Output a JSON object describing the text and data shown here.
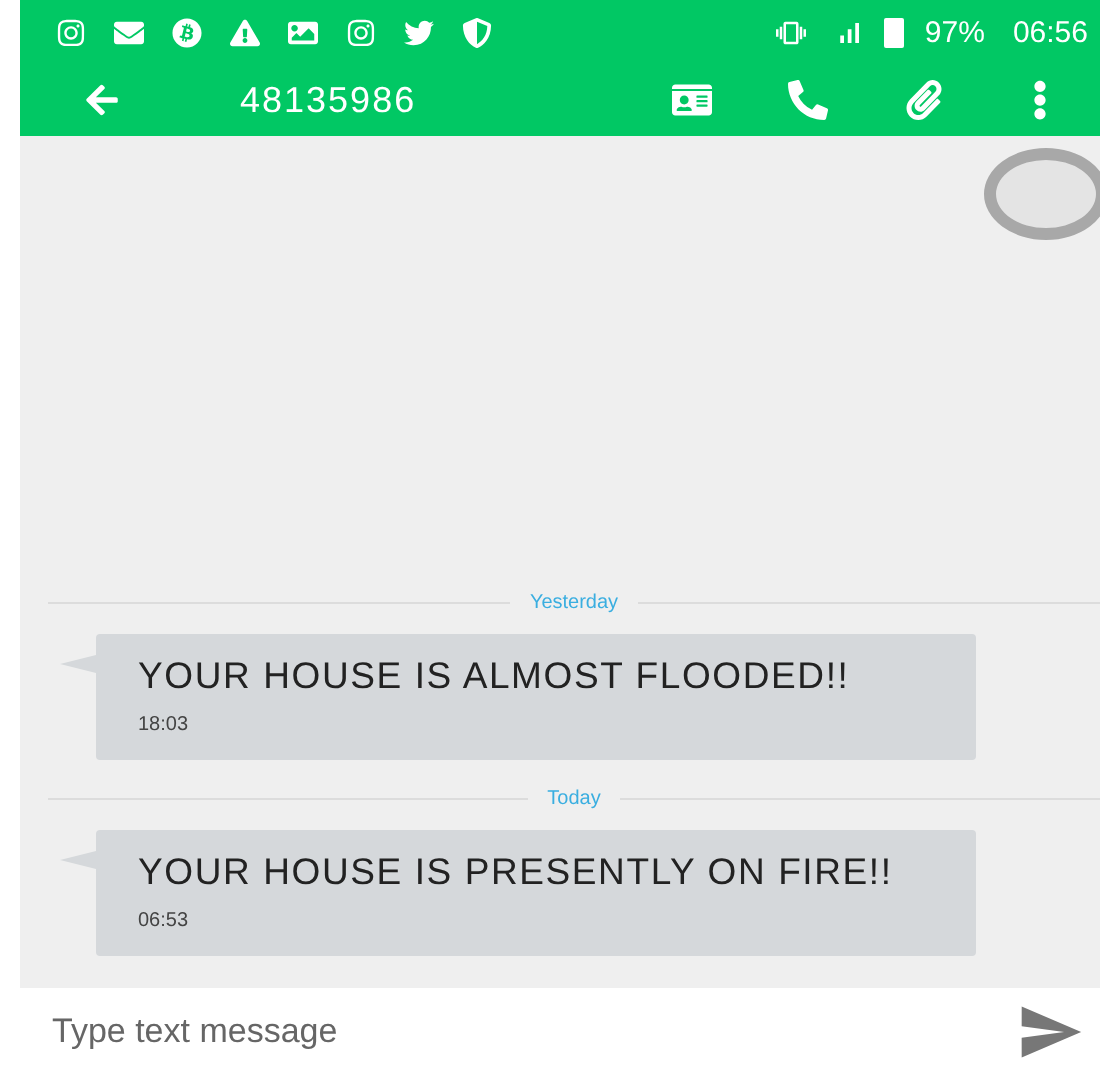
{
  "status_bar": {
    "battery": "97%",
    "time": "06:56"
  },
  "toolbar": {
    "contact": "48135986"
  },
  "conversation": [
    {
      "kind": "divider",
      "label": "Yesterday"
    },
    {
      "kind": "message",
      "text": "YOUR HOUSE IS ALMOST FLOODED!!",
      "time": "18:03"
    },
    {
      "kind": "divider",
      "label": "Today"
    },
    {
      "kind": "message",
      "text": "YOUR HOUSE IS PRESENTLY ON FIRE!!",
      "time": "06:53"
    }
  ],
  "composer": {
    "placeholder": "Type text message"
  }
}
